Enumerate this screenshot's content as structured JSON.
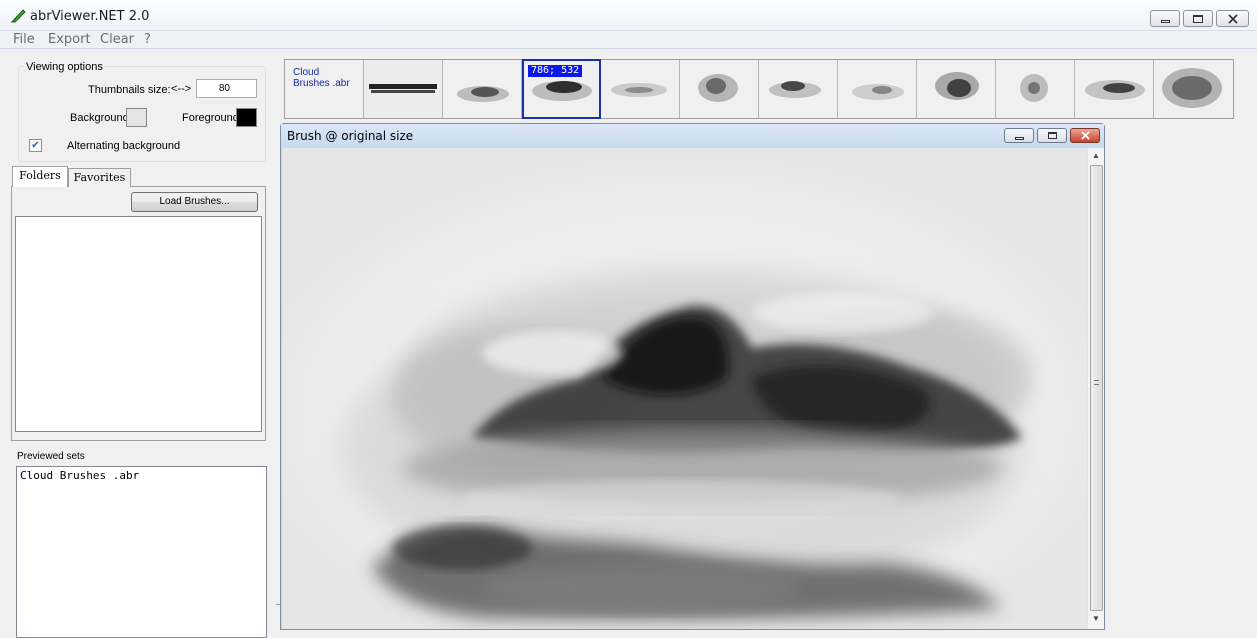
{
  "app": {
    "title": "abrViewer.NET 2.0"
  },
  "menu": {
    "file": "File",
    "export": "Export",
    "clear": "Clear",
    "help": "?"
  },
  "viewing_options": {
    "legend": "Viewing options",
    "thumb_size_label": "Thumbnails size:",
    "thumb_size_arrow": "<-->",
    "thumb_size_value": "80",
    "background_label": "Background:",
    "foreground_label": "Foreground:",
    "background_color": "#e4e4e4",
    "foreground_color": "#000000",
    "alternating_label": "Alternating background",
    "alternating_checked": true
  },
  "tabs": {
    "folders": "Folders",
    "favorites": "Favorites"
  },
  "load_button": "Load Brushes...",
  "previewed": {
    "label": "Previewed sets",
    "items": [
      "Cloud Brushes .abr"
    ]
  },
  "thumbnails": {
    "set_name_line1": "Cloud",
    "set_name_line2": "Brushes .abr",
    "selected_coords": "786; 532",
    "selected_index": 3
  },
  "child_window": {
    "title": "Brush @ original size"
  }
}
